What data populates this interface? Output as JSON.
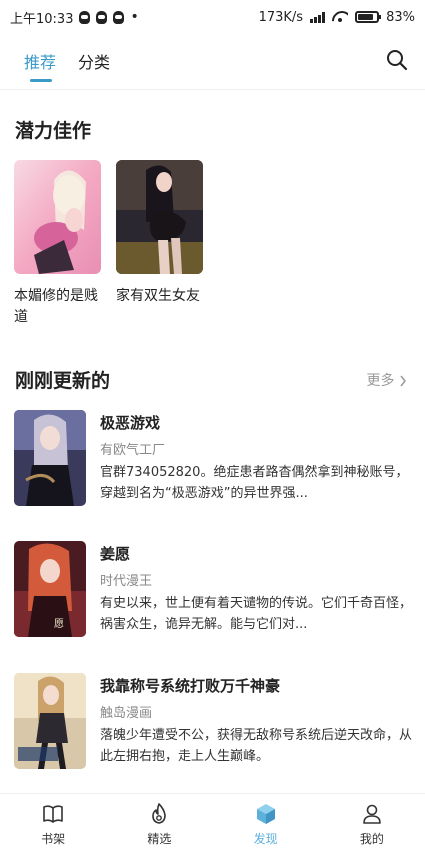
{
  "status_bar": {
    "time": "上午10:33",
    "dot": "•",
    "speed": "173K/s",
    "battery": "83%",
    "battery_level": 0.83
  },
  "top_tabs": [
    {
      "label": "推荐",
      "active": true
    },
    {
      "label": "分类",
      "active": false
    }
  ],
  "icons": {
    "search": "search-icon",
    "more": "chevron-right-icon"
  },
  "featured": {
    "title": "潜力佳作",
    "items": [
      {
        "title": "本媚修的是贱道"
      },
      {
        "title": "家有双生女友"
      }
    ]
  },
  "updates": {
    "title": "刚刚更新的",
    "more_label": "更多",
    "items": [
      {
        "title": "极恶游戏",
        "author": "有欧气工厂",
        "desc": "官群734052820。绝症患者路杳偶然拿到神秘账号，穿越到名为“极恶游戏”的异世界强..."
      },
      {
        "title": "姜愿",
        "author": "时代漫王",
        "desc": "有史以来，世上便有着天谴物的传说。它们千奇百怪，祸害众生，诡异无解。能与它们对..."
      },
      {
        "title": "我靠称号系统打败万千神豪",
        "author": "触岛漫画",
        "desc": "落魄少年遭受不公，获得无敌称号系统后逆天改命，从此左拥右抱，走上人生巅峰。"
      }
    ]
  },
  "bottom_nav": [
    {
      "label": "书架",
      "icon": "book-icon"
    },
    {
      "label": "精选",
      "icon": "flame-icon"
    },
    {
      "label": "发现",
      "icon": "cube-icon",
      "active": true
    },
    {
      "label": "我的",
      "icon": "user-icon"
    }
  ],
  "colors": {
    "accent": "#3b9bc8",
    "nav_active": "#5bb0dc"
  }
}
